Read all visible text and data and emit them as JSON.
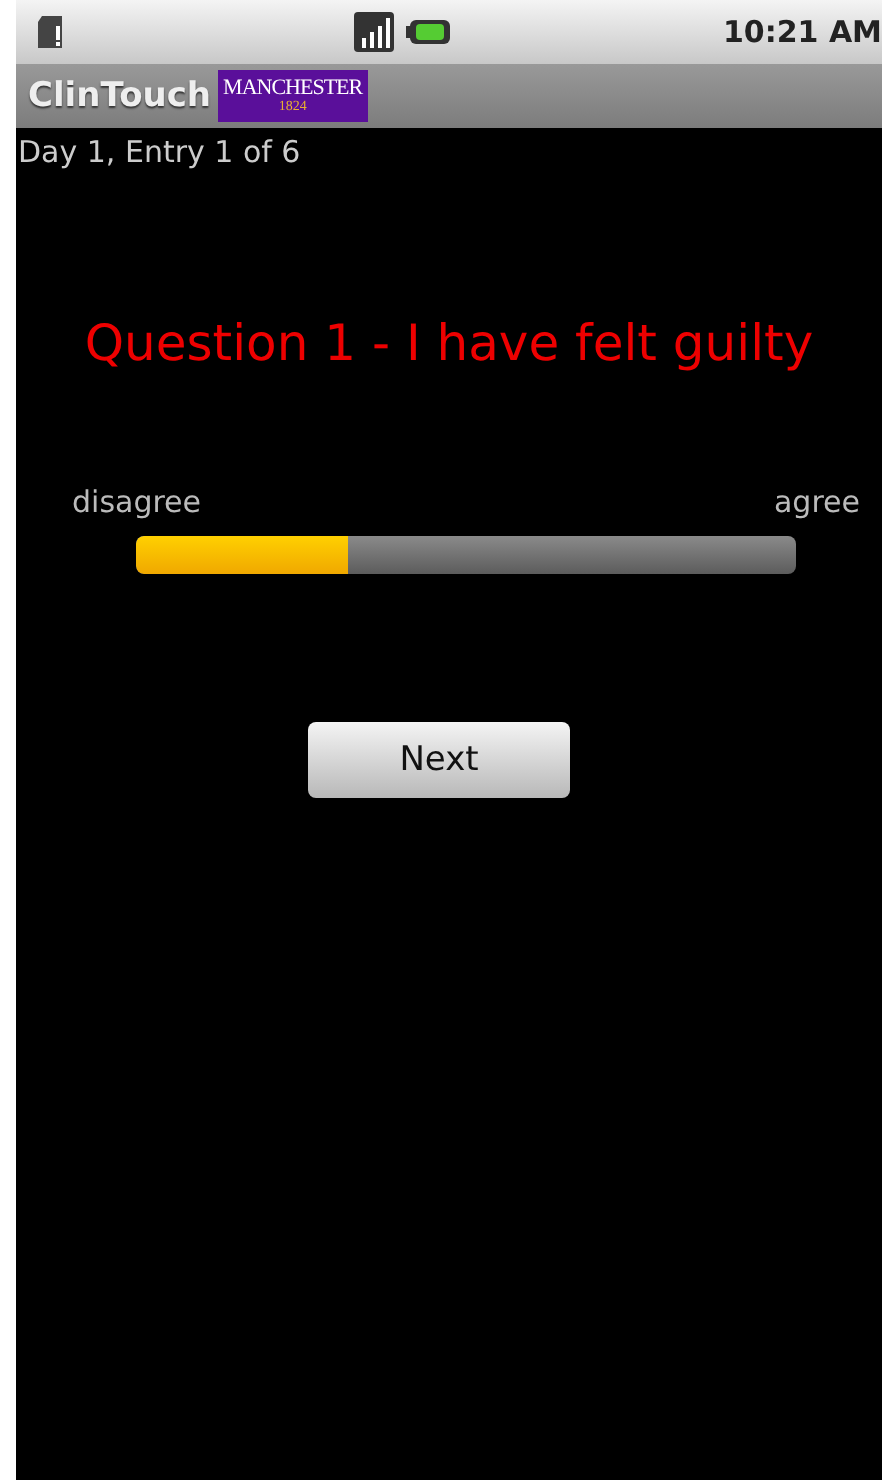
{
  "status_bar": {
    "time": "10:21 AM"
  },
  "title_bar": {
    "title": "ClinTouch",
    "logo": {
      "name": "MANCHESTER",
      "year": "1824"
    }
  },
  "entry_label": "Day 1, Entry 1 of 6",
  "question": "Question 1 - I have felt guilty",
  "scale": {
    "min_label": "disagree",
    "max_label": "agree",
    "level": 0.32
  },
  "buttons": [
    "Next"
  ]
}
